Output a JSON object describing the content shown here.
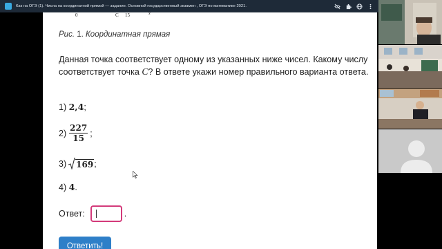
{
  "browser": {
    "tab_title": "Как на ОГЭ (1). Числа на координатной прямой — задание. Основной государственный экзамен , ОГЭ по математике 2021.",
    "icons": [
      "eye-off-icon",
      "extension-icon",
      "globe-icon",
      "menu-icon"
    ]
  },
  "axis": {
    "labels": [
      "0",
      "C",
      "15",
      "x"
    ]
  },
  "caption": {
    "prefix": "Рис.",
    "number": "1.",
    "text": "Координатная прямая"
  },
  "question": {
    "text_before": "Данная точка соответствует одному из указанных ниже чисел. Какому числу соответствует точка ",
    "variable": "C",
    "text_after": "? В ответе укажи номер правильного варианта ответа."
  },
  "options": [
    {
      "label": "1)",
      "value": "2,4",
      "suffix": ";"
    },
    {
      "label": "2)",
      "numerator": "227",
      "denominator": "15",
      "suffix": ";"
    },
    {
      "label": "3)",
      "radicand": "169",
      "suffix": ";"
    },
    {
      "label": "4)",
      "value": "4",
      "suffix": "."
    }
  ],
  "answer": {
    "label": "Ответ:",
    "value": "",
    "trailing": "."
  },
  "submit": {
    "label": "Ответить!"
  },
  "colors": {
    "title_bar": "#1e2a38",
    "input_border": "#d33a7a",
    "button": "#2e7fc8"
  }
}
